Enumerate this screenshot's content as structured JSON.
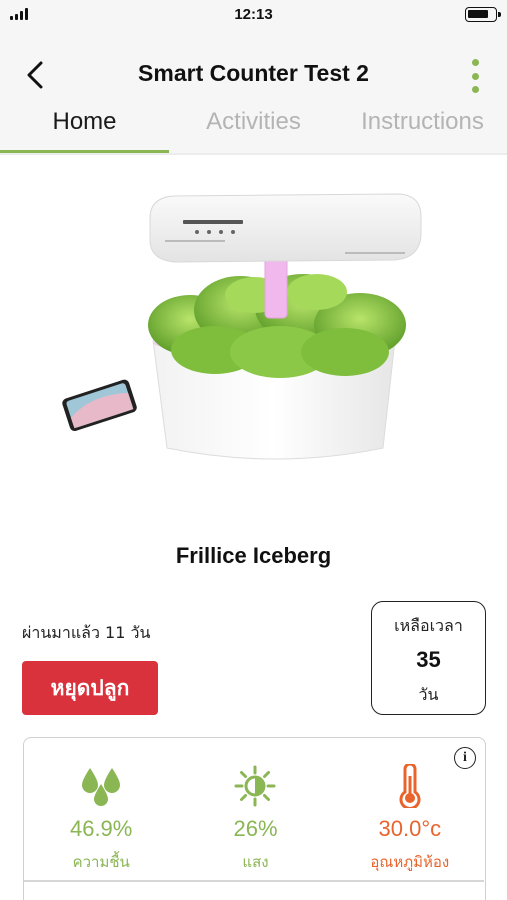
{
  "status_bar": {
    "time": "12:13"
  },
  "header": {
    "title": "Smart Counter Test 2"
  },
  "tabs": [
    {
      "label": "Home",
      "active": true
    },
    {
      "label": "Activities",
      "active": false
    },
    {
      "label": "Instructions",
      "active": false
    }
  ],
  "plant": {
    "name": "Frillice Iceberg",
    "elapsed": "ผ่านมาแล้ว 11 วัน",
    "stop_button": "หยุดปลูก"
  },
  "remaining": {
    "label": "เหลือเวลา",
    "value": "35",
    "unit": "วัน"
  },
  "sensors": [
    {
      "icon": "water-drops-icon",
      "value": "46.9%",
      "label": "ความชื้น",
      "color": "#8ab654"
    },
    {
      "icon": "sun-icon",
      "value": "26%",
      "label": "แสง",
      "color": "#8ab654"
    },
    {
      "icon": "thermometer-icon",
      "value": "30.0°c",
      "label": "อุณหภูมิห้อง",
      "color": "#e8642c"
    }
  ],
  "colors": {
    "accent": "#8ab654",
    "danger": "#d9323c",
    "temperature": "#e8642c"
  }
}
